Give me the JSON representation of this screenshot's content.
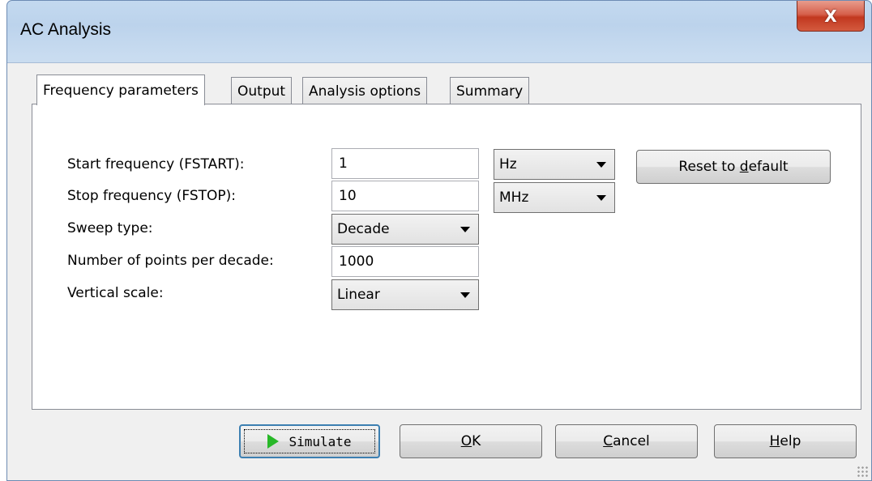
{
  "window": {
    "title": "AC Analysis",
    "close_glyph": "X"
  },
  "tabs": [
    {
      "label": "Frequency parameters",
      "active": true
    },
    {
      "label": "Output",
      "active": false
    },
    {
      "label": "Analysis options",
      "active": false
    },
    {
      "label": "Summary",
      "active": false
    }
  ],
  "fields": {
    "start_frequency": {
      "label": "Start frequency (FSTART):",
      "value": "1",
      "unit": "Hz"
    },
    "stop_frequency": {
      "label": "Stop frequency (FSTOP):",
      "value": "10",
      "unit": "MHz"
    },
    "sweep_type": {
      "label": "Sweep type:",
      "value": "Decade"
    },
    "points_per_decade": {
      "label": "Number of points per decade:",
      "value": "1000"
    },
    "vertical_scale": {
      "label": "Vertical scale:",
      "value": "Linear"
    }
  },
  "reset_button": {
    "before": "Reset to ",
    "mnemonic": "d",
    "after": "efault"
  },
  "buttons": {
    "simulate": {
      "label": "Simulate",
      "icon": "play-icon"
    },
    "ok": {
      "mnemonic": "O",
      "after": "K"
    },
    "cancel": {
      "mnemonic": "C",
      "after": "ancel"
    },
    "help": {
      "mnemonic": "H",
      "after": "elp"
    }
  },
  "colors": {
    "accent_focus": "#3c7fb1",
    "play_icon": "#28b828",
    "close_button": "#c2381f"
  }
}
